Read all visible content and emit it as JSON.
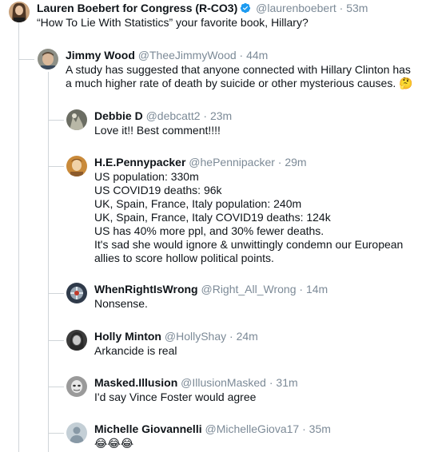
{
  "tweets": [
    {
      "name": "Lauren Boebert for Congress (R-CO3)",
      "handle": "@laurenboebert",
      "time": "53m",
      "lines": [
        "“How To Lie With Statistics” your favorite book, Hillary?"
      ]
    },
    {
      "name": "Jimmy Wood",
      "handle": "@TheeJimmyWood",
      "time": "44m",
      "lines": [
        "A study has suggested that anyone connected with Hillary Clinton has",
        "a much higher rate of death by suicide or other mysterious causes."
      ],
      "emoji": "🤔"
    },
    {
      "name": "Debbie D",
      "handle": "@debcatt2",
      "time": "23m",
      "lines": [
        "Love it!! Best comment!!!!"
      ]
    },
    {
      "name": "H.E.Pennypacker",
      "handle": "@hePennipacker",
      "time": "29m",
      "lines": [
        "US population: 330m",
        "US COVID19 deaths: 96k",
        "UK, Spain, France, Italy population: 240m",
        "UK, Spain, France, Italy COVID19 deaths: 124k",
        "US has 40% more ppl, and 30% fewer deaths.",
        "It's sad she would ignore & unwittingly condemn our European",
        "allies to score hollow political points."
      ]
    },
    {
      "name": "WhenRightIsWrong",
      "handle": "@Right_All_Wrong",
      "time": "14m",
      "lines": [
        "Nonsense."
      ]
    },
    {
      "name": "Holly Minton",
      "handle": "@HollyShay",
      "time": "24m",
      "lines": [
        "Arkancide is real"
      ]
    },
    {
      "name": "Masked.Illusion",
      "handle": "@IllusionMasked",
      "time": "31m",
      "lines": [
        "I'd say Vince Foster would agree"
      ]
    },
    {
      "name": "Michelle Giovannelli",
      "handle": "@MichelleGiova17",
      "time": "35m",
      "lines": [
        "😂😂😂"
      ]
    }
  ],
  "separator": "·",
  "colors": {
    "name": "#0f1419",
    "meta": "#7c8a97",
    "thread_line": "#d0d5d9",
    "verified": "#1d9bf0"
  }
}
